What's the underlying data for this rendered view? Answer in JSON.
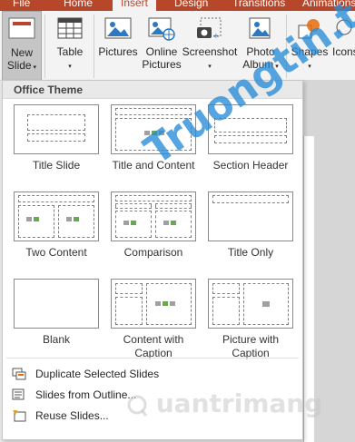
{
  "tabs": [
    "File",
    "Home",
    "Insert",
    "Design",
    "Transitions",
    "Animations"
  ],
  "active_tab": "Insert",
  "ribbon": {
    "new_slide_line1": "New",
    "new_slide_line2": "Slide",
    "table": "Table",
    "pictures": "Pictures",
    "online_pictures_line1": "Online",
    "online_pictures_line2": "Pictures",
    "screenshot": "Screenshot",
    "photo_album_line1": "Photo",
    "photo_album_line2": "Album",
    "shapes": "Shapes",
    "icons": "Icons"
  },
  "panel": {
    "header": "Office Theme",
    "layouts": [
      {
        "label_line1": "Title Slide",
        "label_line2": ""
      },
      {
        "label_line1": "Title and Content",
        "label_line2": ""
      },
      {
        "label_line1": "Section Header",
        "label_line2": ""
      },
      {
        "label_line1": "Two Content",
        "label_line2": ""
      },
      {
        "label_line1": "Comparison",
        "label_line2": ""
      },
      {
        "label_line1": "Title Only",
        "label_line2": ""
      },
      {
        "label_line1": "Blank",
        "label_line2": ""
      },
      {
        "label_line1": "Content with",
        "label_line2": "Caption"
      },
      {
        "label_line1": "Picture with",
        "label_line2": "Caption"
      }
    ],
    "menu": [
      {
        "label": "Duplicate Selected Slides",
        "icon": "duplicate-slides-icon"
      },
      {
        "label": "Slides from Outline...",
        "icon": "outline-icon"
      },
      {
        "label": "Reuse Slides...",
        "icon": "reuse-slides-icon"
      }
    ]
  },
  "watermarks": {
    "primary": "Truongtin.top",
    "secondary": "uantrimang"
  },
  "colors": {
    "accent": "#b7472a",
    "watermark_blue": "#288cd7"
  }
}
